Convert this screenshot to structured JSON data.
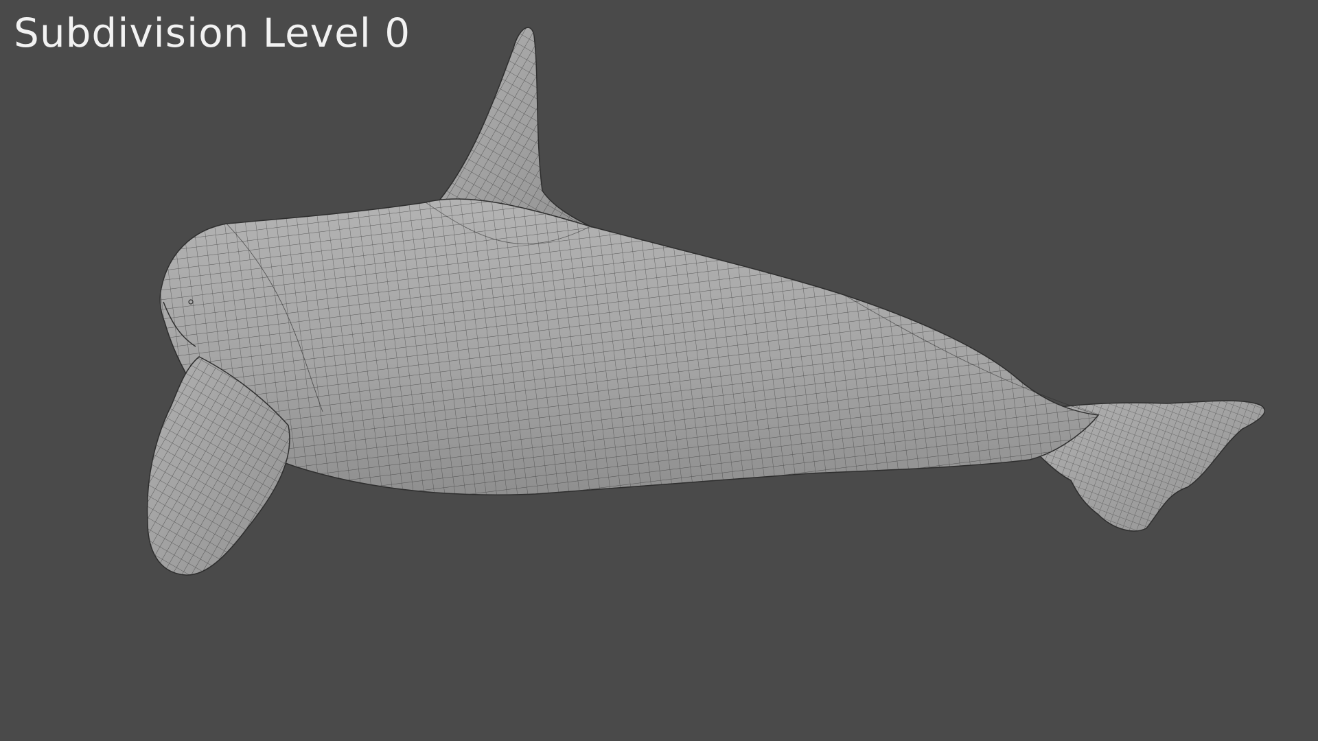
{
  "viewport": {
    "overlay_text": "Subdivision Level 0",
    "background_color": "#4a4a4a",
    "model": {
      "subject": "orca",
      "display": "wireframe-on-shaded",
      "surface_color": "#a3a3a3",
      "wire_color": "#3a3a3a"
    }
  }
}
